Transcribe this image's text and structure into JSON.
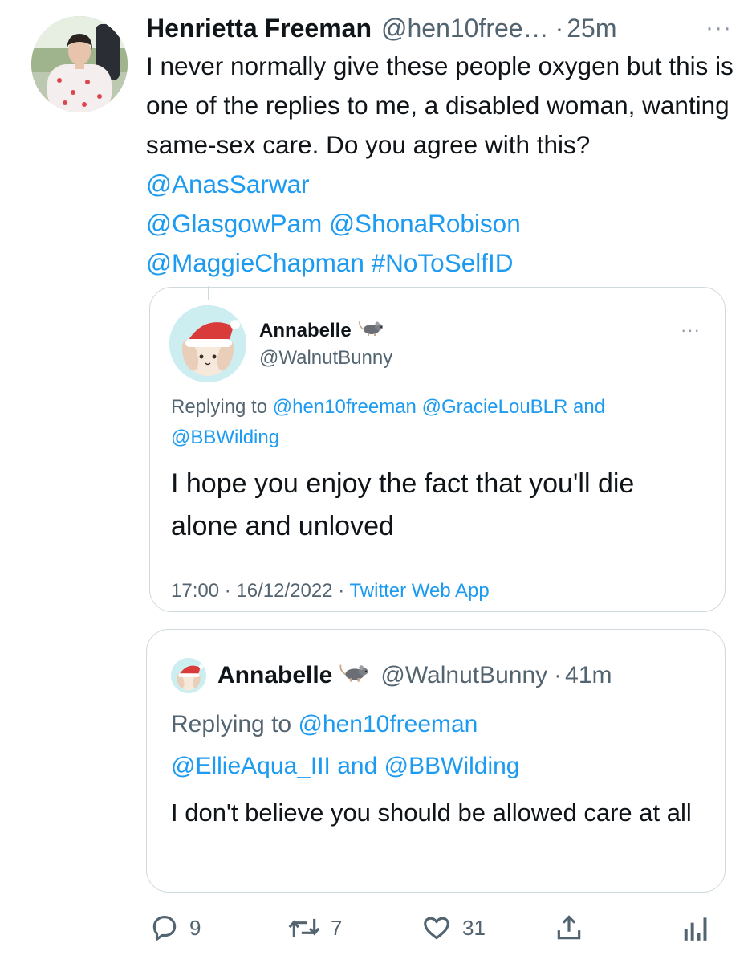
{
  "tweet": {
    "author_name": "Henrietta Freeman",
    "author_handle": "@hen10free…",
    "separator": "·",
    "time": "25m",
    "more": "···",
    "text_plain": "I never normally give these people oxygen but this is one of the replies to me, a disabled woman, wanting same-sex care. Do you agree with this?",
    "mentions": [
      "@AnasSarwar",
      "@GlasgowPam",
      "@ShonaRobison",
      "@MaggieChapman"
    ],
    "hashtag": "#NoToSelfID"
  },
  "quote1": {
    "name": "Annabelle",
    "handle": "@WalnutBunny",
    "more": "···",
    "replying_to_label": "Replying to",
    "replying_to": [
      "@hen10freeman",
      "@GracieLouBLR",
      "@BBWilding"
    ],
    "and_word": "and",
    "text": "I hope you enjoy the fact that you'll die alone and unloved",
    "time": "17:00",
    "date": "16/12/2022",
    "source": "Twitter Web App",
    "separator": "·"
  },
  "quote2": {
    "name": "Annabelle",
    "handle": "@WalnutBunny",
    "separator": "·",
    "time": "41m",
    "replying_to_label": "Replying to",
    "replying_to": [
      "@hen10freeman",
      "@EllieAqua_III",
      "@BBWilding"
    ],
    "and_word": "and",
    "text": "I don't believe you should be allowed care at all"
  },
  "actions": {
    "replies": "9",
    "retweets": "7",
    "likes": "31"
  },
  "colors": {
    "link": "#1d9bf0",
    "secondary_text": "#536471",
    "border": "#cfd9de"
  },
  "icons": [
    "reply-icon",
    "retweet-icon",
    "like-icon",
    "share-icon",
    "analytics-icon",
    "rat-icon",
    "more-icon"
  ]
}
